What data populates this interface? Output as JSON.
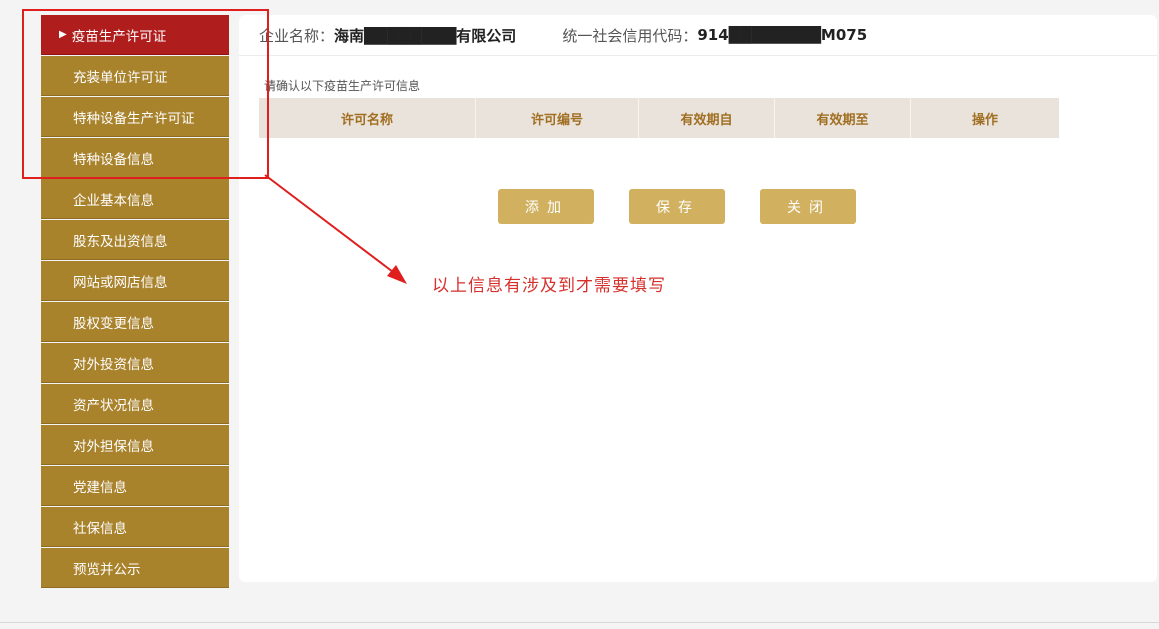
{
  "sidebar": {
    "items": [
      {
        "label": "疫苗生产许可证",
        "active": true
      },
      {
        "label": "充装单位许可证"
      },
      {
        "label": "特种设备生产许可证"
      },
      {
        "label": "特种设备信息"
      },
      {
        "label": "企业基本信息"
      },
      {
        "label": "股东及出资信息"
      },
      {
        "label": "网站或网店信息"
      },
      {
        "label": "股权变更信息"
      },
      {
        "label": "对外投资信息"
      },
      {
        "label": "资产状况信息"
      },
      {
        "label": "对外担保信息"
      },
      {
        "label": "党建信息"
      },
      {
        "label": "社保信息"
      },
      {
        "label": "预览并公示"
      }
    ],
    "active_marker": "triangle-right-icon"
  },
  "header": {
    "company_label": "企业名称：",
    "company_value": "海南████████有限公司",
    "credit_label": "统一社会信用代码：",
    "credit_value": "914████████M075"
  },
  "main": {
    "notice": "请确认以下疫苗生产许可信息",
    "table": {
      "columns": [
        "许可名称",
        "许可编号",
        "有效期自",
        "有效期至",
        "操作"
      ],
      "rows": []
    },
    "buttons": {
      "add": "添加",
      "save": "保存",
      "close": "关闭"
    }
  },
  "annotation": {
    "text": "以上信息有涉及到才需要填写",
    "color": "#d6302c"
  },
  "colors": {
    "sidebar_bg": "#a9822c",
    "sidebar_active_bg": "#b01d1d",
    "button_bg": "#d1b160",
    "table_header_bg": "#eae3dc",
    "table_header_text": "#a06f22"
  }
}
